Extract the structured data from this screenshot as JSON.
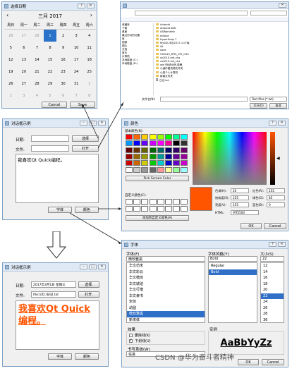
{
  "calendar": {
    "title": "选择日期",
    "month_label": "三月 2017",
    "weekdays": [
      "周日",
      "周一",
      "周二",
      "周三",
      "周四",
      "周五",
      "周六"
    ],
    "rows": [
      [
        "26",
        "27",
        "28",
        "1",
        "2",
        "3",
        "4"
      ],
      [
        "5",
        "6",
        "7",
        "8",
        "9",
        "10",
        "11"
      ],
      [
        "12",
        "13",
        "14",
        "15",
        "16",
        "17",
        "18"
      ],
      [
        "19",
        "20",
        "21",
        "22",
        "23",
        "24",
        "25"
      ],
      [
        "26",
        "27",
        "28",
        "29",
        "30",
        "31",
        "1"
      ],
      [
        "2",
        "3",
        "4",
        "5",
        "6",
        "7",
        "8"
      ]
    ],
    "selected_day": "1",
    "cancel_label": "Cancel",
    "save_label": "Save"
  },
  "dialog1": {
    "title": "对话框示例",
    "date_label": "日期:",
    "date_button": "选择",
    "file_label": "文件:",
    "file_button": "打开",
    "text": "我喜欢Qt Quick编程。",
    "font_button": "字体",
    "color_button": "颜色"
  },
  "dialog2": {
    "title": "对话框示例",
    "date_label": "日期:",
    "date_value": "2017年3月1日 星期三",
    "date_button": "选择.",
    "file_label": "文件:",
    "file_value": "file:///D:/日记.txt",
    "file_button": "打开.",
    "text": "我喜欢Qt Quick编程。",
    "font_button": "字体",
    "color_button": "颜色"
  },
  "file_dialog": {
    "folders": [
      "Android",
      "Android SDK",
      "ASWorkdisk",
      "eclipse",
      "HyperSnap 7",
      "MySQL平台2017.1.07版",
      "Qt",
      "save",
      "VS2015_RTM_ULT_CHS",
      "vs2015-ent_chs",
      "vs2015-ent_chs",
      "win7系统示例-原稿",
      "小道作图资源文件夹",
      "小型个人计算机",
      "新建文件夹"
    ],
    "files": [
      "日记.txt"
    ],
    "nav": [
      "收藏夹",
      "下载",
      "桌面",
      "最近访问的位置",
      "库",
      "视频",
      "图片",
      "文档",
      "音乐",
      "计算机",
      "本地磁盘 (C:)",
      "本地磁盘 (D:)"
    ],
    "filename_label": "文件名(N):",
    "filter": "Text files (*.txt)",
    "open_label": "打开(O)",
    "cancel_label": "取消"
  },
  "color_dialog": {
    "title": "颜色",
    "basic_label": "基本颜色(B):",
    "pick_button": "Pick Screen Color",
    "custom_label": "自定义颜色(C):",
    "add_custom_button": "添加到自定义颜色(A)",
    "hue_label": "色调(H):",
    "hue": "20",
    "sat_label": "饱和度(S):",
    "sat": "255",
    "val_label": "亮度(V):",
    "val": "255",
    "red_label": "红色(R):",
    "red": "255",
    "green_label": "绿色(G):",
    "green": "85",
    "blue_label": "蓝色(B):",
    "blue": "0",
    "html_label": "HTML:",
    "html": "#ff5500",
    "ok_label": "OK",
    "cancel_label": "Cancel",
    "selected_color": "#ff5500"
  },
  "font_dialog": {
    "title": "字体",
    "family_label": "字体(F)",
    "family_value": "微软雅黑",
    "families": [
      "华文仿宋",
      "华文彩云",
      "华文楷体",
      "华文琥珀",
      "华文行楷",
      "华文隶书",
      "宋体",
      "幼圆",
      "微软雅黑",
      "新宋体"
    ],
    "style_label": "字体风格(Y)",
    "style_value": "Bold",
    "styles": [
      "Regular",
      "Bold"
    ],
    "size_label": "大小(S)",
    "size_value": "22",
    "sizes": [
      "12",
      "14",
      "16",
      "18",
      "20",
      "22",
      "24",
      "26",
      "28",
      "36",
      "48"
    ],
    "effects_label": "效果",
    "strike_label": "删除线(K)",
    "underline_label": "下划线(U)",
    "writing_label": "书写系统(W)",
    "writing_value": "任意",
    "sample_label": "实例",
    "sample_text": "AaBbYyZz",
    "ok_label": "OK",
    "cancel_label": "Cancel"
  },
  "watermark": "CSDN @华为奋斗者精神",
  "colors": {
    "accent": "#2a73c8",
    "chosen": "#ff5500",
    "titlebar": "#dfe9f5"
  }
}
